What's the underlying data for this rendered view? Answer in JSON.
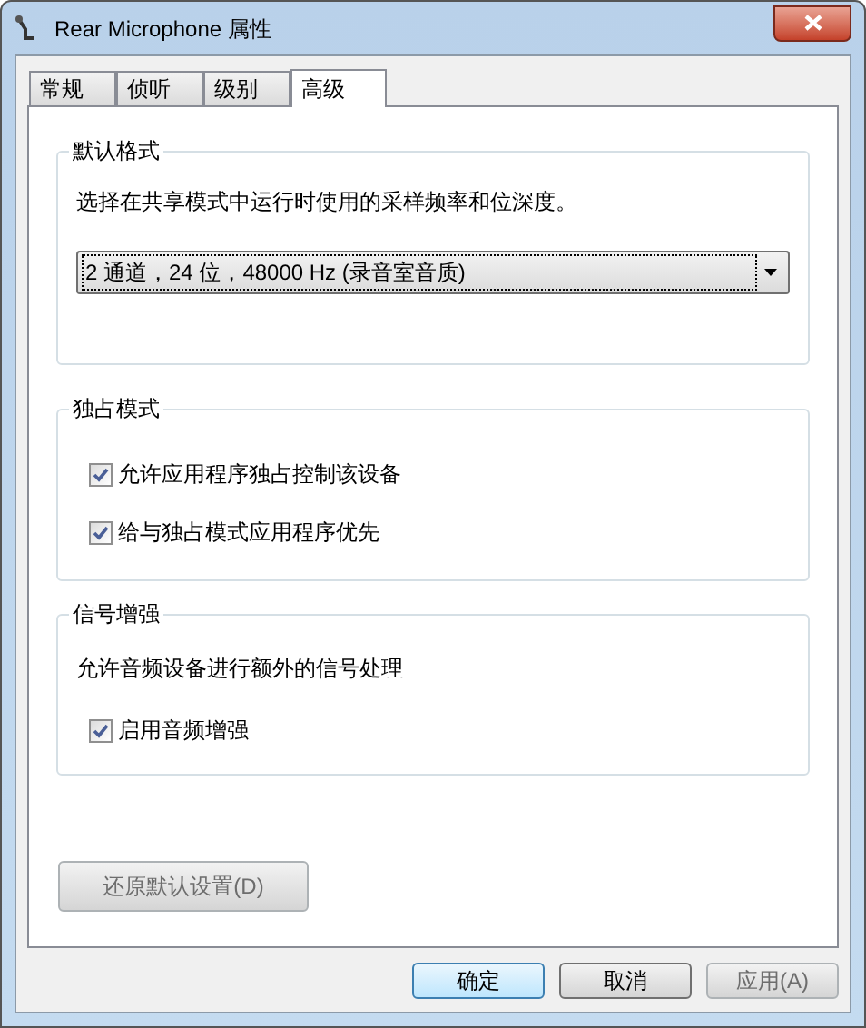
{
  "window": {
    "title": "Rear Microphone 属性"
  },
  "tabs": [
    {
      "label": "常规",
      "selected": false
    },
    {
      "label": "侦听",
      "selected": false
    },
    {
      "label": "级别",
      "selected": false
    },
    {
      "label": "高级",
      "selected": true
    }
  ],
  "default_format": {
    "title": "默认格式",
    "description": "选择在共享模式中运行时使用的采样频率和位深度。",
    "format_select": {
      "value": "2 通道，24 位，48000 Hz (录音室音质)"
    }
  },
  "exclusive_mode": {
    "title": "独占模式",
    "options": [
      {
        "label": "允许应用程序独占控制该设备",
        "checked": true
      },
      {
        "label": "给与独占模式应用程序优先",
        "checked": true
      }
    ]
  },
  "signal_enhancement": {
    "title": "信号增强",
    "description": "允许音频设备进行额外的信号处理",
    "options": [
      {
        "label": "启用音频增强",
        "checked": true
      }
    ]
  },
  "restore_button": {
    "label": "还原默认设置(D)",
    "disabled": true
  },
  "buttons": [
    {
      "label": "确定",
      "disabled": false,
      "default": true
    },
    {
      "label": "取消",
      "disabled": false,
      "default": false
    },
    {
      "label": "应用(A)",
      "disabled": true,
      "default": false
    }
  ]
}
